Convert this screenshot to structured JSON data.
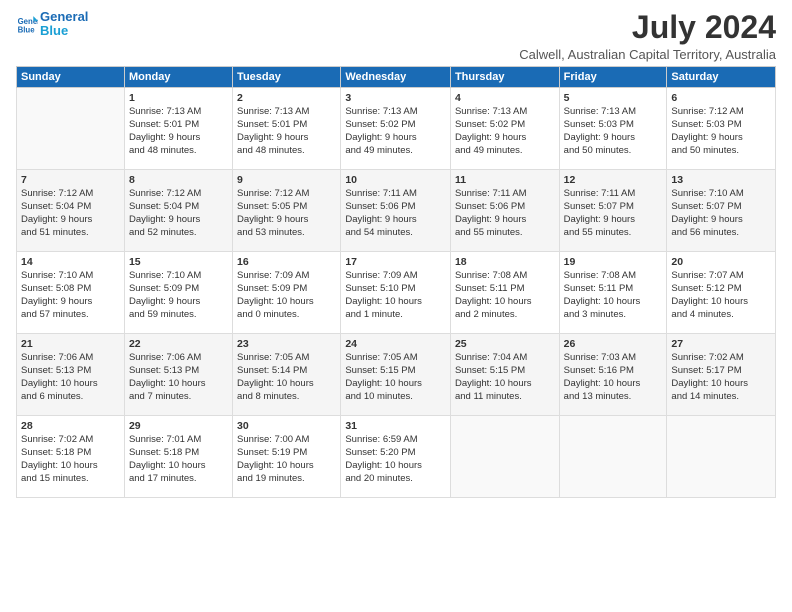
{
  "header": {
    "logo_line1": "General",
    "logo_line2": "Blue",
    "main_title": "July 2024",
    "subtitle": "Calwell, Australian Capital Territory, Australia"
  },
  "calendar": {
    "columns": [
      "Sunday",
      "Monday",
      "Tuesday",
      "Wednesday",
      "Thursday",
      "Friday",
      "Saturday"
    ],
    "rows": [
      [
        {
          "day": "",
          "lines": []
        },
        {
          "day": "1",
          "lines": [
            "Sunrise: 7:13 AM",
            "Sunset: 5:01 PM",
            "Daylight: 9 hours",
            "and 48 minutes."
          ]
        },
        {
          "day": "2",
          "lines": [
            "Sunrise: 7:13 AM",
            "Sunset: 5:01 PM",
            "Daylight: 9 hours",
            "and 48 minutes."
          ]
        },
        {
          "day": "3",
          "lines": [
            "Sunrise: 7:13 AM",
            "Sunset: 5:02 PM",
            "Daylight: 9 hours",
            "and 49 minutes."
          ]
        },
        {
          "day": "4",
          "lines": [
            "Sunrise: 7:13 AM",
            "Sunset: 5:02 PM",
            "Daylight: 9 hours",
            "and 49 minutes."
          ]
        },
        {
          "day": "5",
          "lines": [
            "Sunrise: 7:13 AM",
            "Sunset: 5:03 PM",
            "Daylight: 9 hours",
            "and 50 minutes."
          ]
        },
        {
          "day": "6",
          "lines": [
            "Sunrise: 7:12 AM",
            "Sunset: 5:03 PM",
            "Daylight: 9 hours",
            "and 50 minutes."
          ]
        }
      ],
      [
        {
          "day": "7",
          "lines": [
            "Sunrise: 7:12 AM",
            "Sunset: 5:04 PM",
            "Daylight: 9 hours",
            "and 51 minutes."
          ]
        },
        {
          "day": "8",
          "lines": [
            "Sunrise: 7:12 AM",
            "Sunset: 5:04 PM",
            "Daylight: 9 hours",
            "and 52 minutes."
          ]
        },
        {
          "day": "9",
          "lines": [
            "Sunrise: 7:12 AM",
            "Sunset: 5:05 PM",
            "Daylight: 9 hours",
            "and 53 minutes."
          ]
        },
        {
          "day": "10",
          "lines": [
            "Sunrise: 7:11 AM",
            "Sunset: 5:06 PM",
            "Daylight: 9 hours",
            "and 54 minutes."
          ]
        },
        {
          "day": "11",
          "lines": [
            "Sunrise: 7:11 AM",
            "Sunset: 5:06 PM",
            "Daylight: 9 hours",
            "and 55 minutes."
          ]
        },
        {
          "day": "12",
          "lines": [
            "Sunrise: 7:11 AM",
            "Sunset: 5:07 PM",
            "Daylight: 9 hours",
            "and 55 minutes."
          ]
        },
        {
          "day": "13",
          "lines": [
            "Sunrise: 7:10 AM",
            "Sunset: 5:07 PM",
            "Daylight: 9 hours",
            "and 56 minutes."
          ]
        }
      ],
      [
        {
          "day": "14",
          "lines": [
            "Sunrise: 7:10 AM",
            "Sunset: 5:08 PM",
            "Daylight: 9 hours",
            "and 57 minutes."
          ]
        },
        {
          "day": "15",
          "lines": [
            "Sunrise: 7:10 AM",
            "Sunset: 5:09 PM",
            "Daylight: 9 hours",
            "and 59 minutes."
          ]
        },
        {
          "day": "16",
          "lines": [
            "Sunrise: 7:09 AM",
            "Sunset: 5:09 PM",
            "Daylight: 10 hours",
            "and 0 minutes."
          ]
        },
        {
          "day": "17",
          "lines": [
            "Sunrise: 7:09 AM",
            "Sunset: 5:10 PM",
            "Daylight: 10 hours",
            "and 1 minute."
          ]
        },
        {
          "day": "18",
          "lines": [
            "Sunrise: 7:08 AM",
            "Sunset: 5:11 PM",
            "Daylight: 10 hours",
            "and 2 minutes."
          ]
        },
        {
          "day": "19",
          "lines": [
            "Sunrise: 7:08 AM",
            "Sunset: 5:11 PM",
            "Daylight: 10 hours",
            "and 3 minutes."
          ]
        },
        {
          "day": "20",
          "lines": [
            "Sunrise: 7:07 AM",
            "Sunset: 5:12 PM",
            "Daylight: 10 hours",
            "and 4 minutes."
          ]
        }
      ],
      [
        {
          "day": "21",
          "lines": [
            "Sunrise: 7:06 AM",
            "Sunset: 5:13 PM",
            "Daylight: 10 hours",
            "and 6 minutes."
          ]
        },
        {
          "day": "22",
          "lines": [
            "Sunrise: 7:06 AM",
            "Sunset: 5:13 PM",
            "Daylight: 10 hours",
            "and 7 minutes."
          ]
        },
        {
          "day": "23",
          "lines": [
            "Sunrise: 7:05 AM",
            "Sunset: 5:14 PM",
            "Daylight: 10 hours",
            "and 8 minutes."
          ]
        },
        {
          "day": "24",
          "lines": [
            "Sunrise: 7:05 AM",
            "Sunset: 5:15 PM",
            "Daylight: 10 hours",
            "and 10 minutes."
          ]
        },
        {
          "day": "25",
          "lines": [
            "Sunrise: 7:04 AM",
            "Sunset: 5:15 PM",
            "Daylight: 10 hours",
            "and 11 minutes."
          ]
        },
        {
          "day": "26",
          "lines": [
            "Sunrise: 7:03 AM",
            "Sunset: 5:16 PM",
            "Daylight: 10 hours",
            "and 13 minutes."
          ]
        },
        {
          "day": "27",
          "lines": [
            "Sunrise: 7:02 AM",
            "Sunset: 5:17 PM",
            "Daylight: 10 hours",
            "and 14 minutes."
          ]
        }
      ],
      [
        {
          "day": "28",
          "lines": [
            "Sunrise: 7:02 AM",
            "Sunset: 5:18 PM",
            "Daylight: 10 hours",
            "and 15 minutes."
          ]
        },
        {
          "day": "29",
          "lines": [
            "Sunrise: 7:01 AM",
            "Sunset: 5:18 PM",
            "Daylight: 10 hours",
            "and 17 minutes."
          ]
        },
        {
          "day": "30",
          "lines": [
            "Sunrise: 7:00 AM",
            "Sunset: 5:19 PM",
            "Daylight: 10 hours",
            "and 19 minutes."
          ]
        },
        {
          "day": "31",
          "lines": [
            "Sunrise: 6:59 AM",
            "Sunset: 5:20 PM",
            "Daylight: 10 hours",
            "and 20 minutes."
          ]
        },
        {
          "day": "",
          "lines": []
        },
        {
          "day": "",
          "lines": []
        },
        {
          "day": "",
          "lines": []
        }
      ]
    ]
  }
}
